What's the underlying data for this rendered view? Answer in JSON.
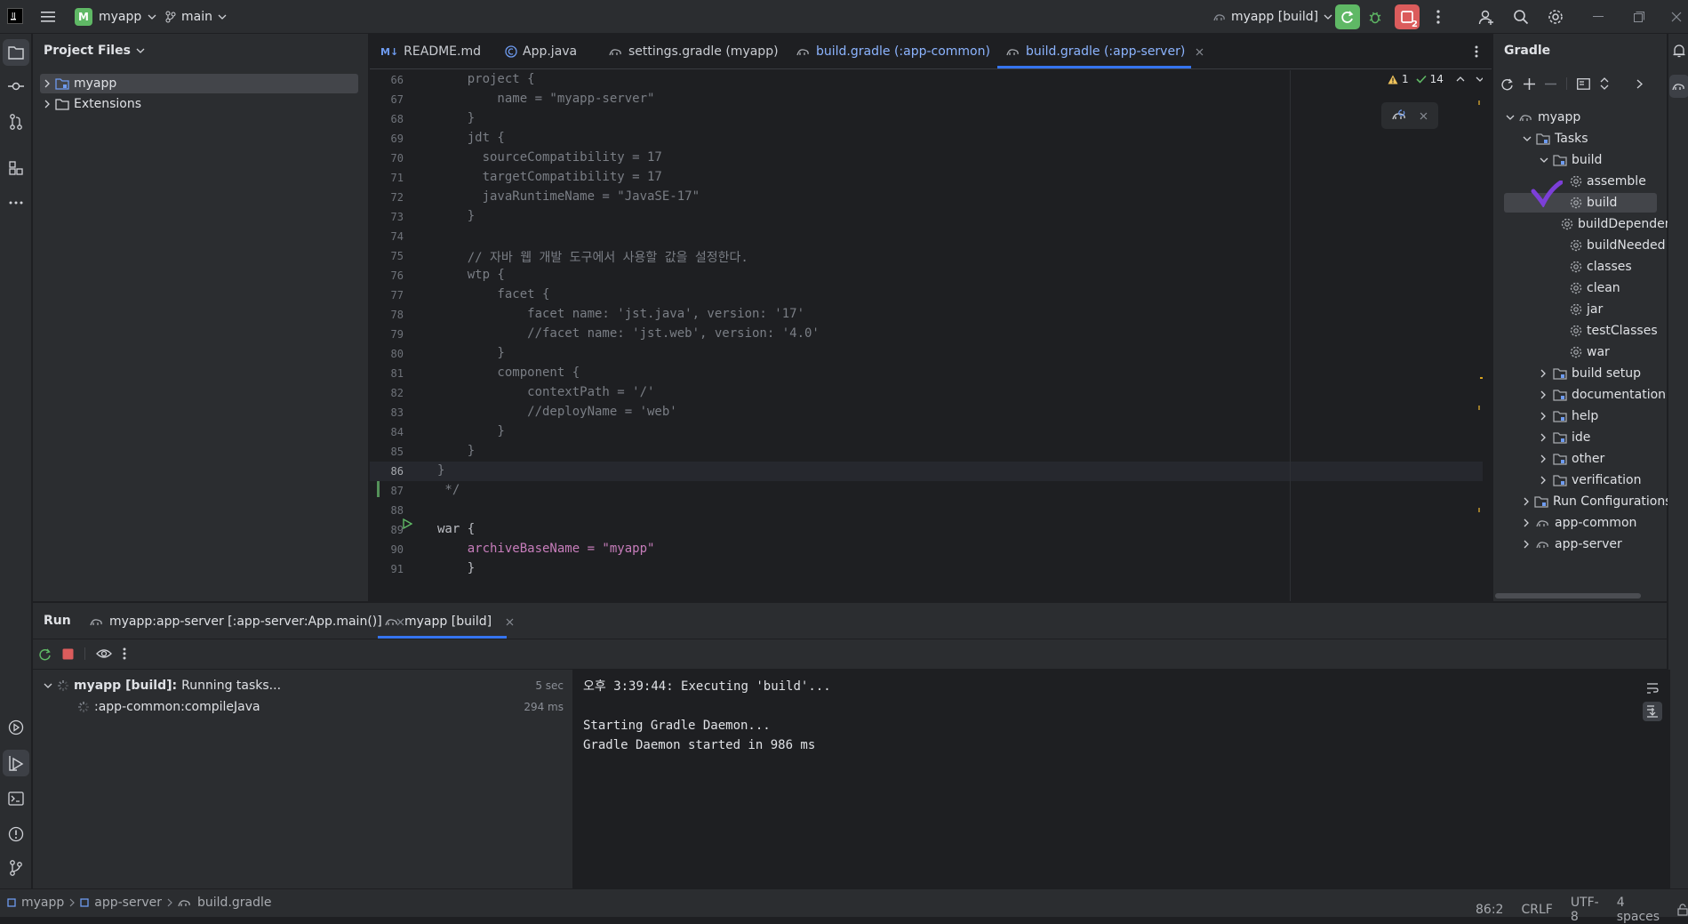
{
  "titlebar": {
    "project_badge": "M",
    "project_name": "myapp",
    "branch": "main",
    "run_config": "myapp [build]",
    "stop_badge_count": "2"
  },
  "project_panel": {
    "title": "Project Files",
    "items": [
      {
        "label": "myapp",
        "selected": true
      },
      {
        "label": "Extensions",
        "selected": false
      }
    ]
  },
  "editor": {
    "tabs": [
      {
        "label": "README.md",
        "icon": "markdown-icon",
        "color": "#c9ccd2"
      },
      {
        "label": "App.java",
        "icon": "java-class-icon",
        "color": "#c9ccd2"
      },
      {
        "label": "settings.gradle (myapp)",
        "icon": "gradle-icon",
        "color": "#c9ccd2"
      },
      {
        "label": "build.gradle (:app-common)",
        "icon": "gradle-icon",
        "color": "#8cb4ff"
      },
      {
        "label": "build.gradle (:app-server)",
        "icon": "gradle-icon",
        "color": "#8cb4ff",
        "active": true
      }
    ],
    "inspection": {
      "warnings": "1",
      "ok": "14"
    },
    "lines": [
      {
        "n": "66",
        "text": "    project {"
      },
      {
        "n": "67",
        "text": "        name = \"myapp-server\""
      },
      {
        "n": "68",
        "text": "    }"
      },
      {
        "n": "69",
        "text": "    jdt {"
      },
      {
        "n": "70",
        "text": "      sourceCompatibility = 17"
      },
      {
        "n": "71",
        "text": "      targetCompatibility = 17"
      },
      {
        "n": "72",
        "text": "      javaRuntimeName = \"JavaSE-17\""
      },
      {
        "n": "73",
        "text": "    }"
      },
      {
        "n": "74",
        "text": ""
      },
      {
        "n": "75",
        "text": "    // 자바 웹 개발 도구에서 사용할 값을 설정한다."
      },
      {
        "n": "76",
        "text": "    wtp {"
      },
      {
        "n": "77",
        "text": "        facet {"
      },
      {
        "n": "78",
        "text": "            facet name: 'jst.java', version: '17'"
      },
      {
        "n": "79",
        "text": "            //facet name: 'jst.web', version: '4.0'"
      },
      {
        "n": "80",
        "text": "        }"
      },
      {
        "n": "81",
        "text": "        component {"
      },
      {
        "n": "82",
        "text": "            contextPath = '/'"
      },
      {
        "n": "83",
        "text": "            //deployName = 'web'"
      },
      {
        "n": "84",
        "text": "        }"
      },
      {
        "n": "85",
        "text": "    }"
      },
      {
        "n": "86",
        "text": "}"
      },
      {
        "n": "87",
        "text": " */"
      },
      {
        "n": "88",
        "text": ""
      },
      {
        "n": "89",
        "text": "war {"
      },
      {
        "n": "90",
        "text": "    archiveBaseName = \"myapp\""
      },
      {
        "n": "91",
        "text": "    }"
      }
    ]
  },
  "gradle": {
    "title": "Gradle",
    "tree": [
      {
        "label": "myapp",
        "depth": 0,
        "icon": "gradle-project-icon",
        "expander": "down"
      },
      {
        "label": "Tasks",
        "depth": 1,
        "icon": "folder-icon",
        "expander": "down"
      },
      {
        "label": "build",
        "depth": 2,
        "icon": "folder-icon",
        "expander": "down"
      },
      {
        "label": "assemble",
        "depth": 3,
        "icon": "gear-icon"
      },
      {
        "label": "build",
        "depth": 3,
        "icon": "gear-icon",
        "selected": true
      },
      {
        "label": "buildDependents",
        "depth": 3,
        "icon": "gear-icon"
      },
      {
        "label": "buildNeeded",
        "depth": 3,
        "icon": "gear-icon"
      },
      {
        "label": "classes",
        "depth": 3,
        "icon": "gear-icon"
      },
      {
        "label": "clean",
        "depth": 3,
        "icon": "gear-icon"
      },
      {
        "label": "jar",
        "depth": 3,
        "icon": "gear-icon"
      },
      {
        "label": "testClasses",
        "depth": 3,
        "icon": "gear-icon"
      },
      {
        "label": "war",
        "depth": 3,
        "icon": "gear-icon"
      },
      {
        "label": "build setup",
        "depth": 2,
        "icon": "folder-icon",
        "expander": "right"
      },
      {
        "label": "documentation",
        "depth": 2,
        "icon": "folder-icon",
        "expander": "right"
      },
      {
        "label": "help",
        "depth": 2,
        "icon": "folder-icon",
        "expander": "right"
      },
      {
        "label": "ide",
        "depth": 2,
        "icon": "folder-icon",
        "expander": "right"
      },
      {
        "label": "other",
        "depth": 2,
        "icon": "folder-icon",
        "expander": "right"
      },
      {
        "label": "verification",
        "depth": 2,
        "icon": "folder-icon",
        "expander": "right"
      },
      {
        "label": "Run Configurations",
        "depth": 1,
        "icon": "folder-icon",
        "expander": "right"
      },
      {
        "label": "app-common",
        "depth": 1,
        "icon": "gradle-project-icon",
        "expander": "right"
      },
      {
        "label": "app-server",
        "depth": 1,
        "icon": "gradle-project-icon",
        "expander": "right"
      }
    ]
  },
  "run": {
    "title": "Run",
    "tabs": [
      {
        "label": "myapp:app-server [:app-server:App.main()]"
      },
      {
        "label": "myapp [build]",
        "active": true
      }
    ],
    "tree": {
      "root_bold": "myapp [build]:",
      "root_status": "Running tasks...",
      "root_time": "5 sec",
      "child_label": ":app-common:compileJava",
      "child_time": "294 ms"
    },
    "console": [
      "오후 3:39:44: Executing 'build'...",
      "",
      "Starting Gradle Daemon...",
      "Gradle Daemon started in 986 ms"
    ]
  },
  "status": {
    "breadcrumb": [
      "myapp",
      "app-server",
      "build.gradle"
    ],
    "position": "86:2",
    "line_sep": "CRLF",
    "encoding": "UTF-8",
    "indent": "4 spaces"
  },
  "colors": {
    "accent": "#3574f0",
    "run_green": "#5fb865",
    "stop_red": "#db5c5c",
    "annotation_purple": "#7c3fd8"
  }
}
